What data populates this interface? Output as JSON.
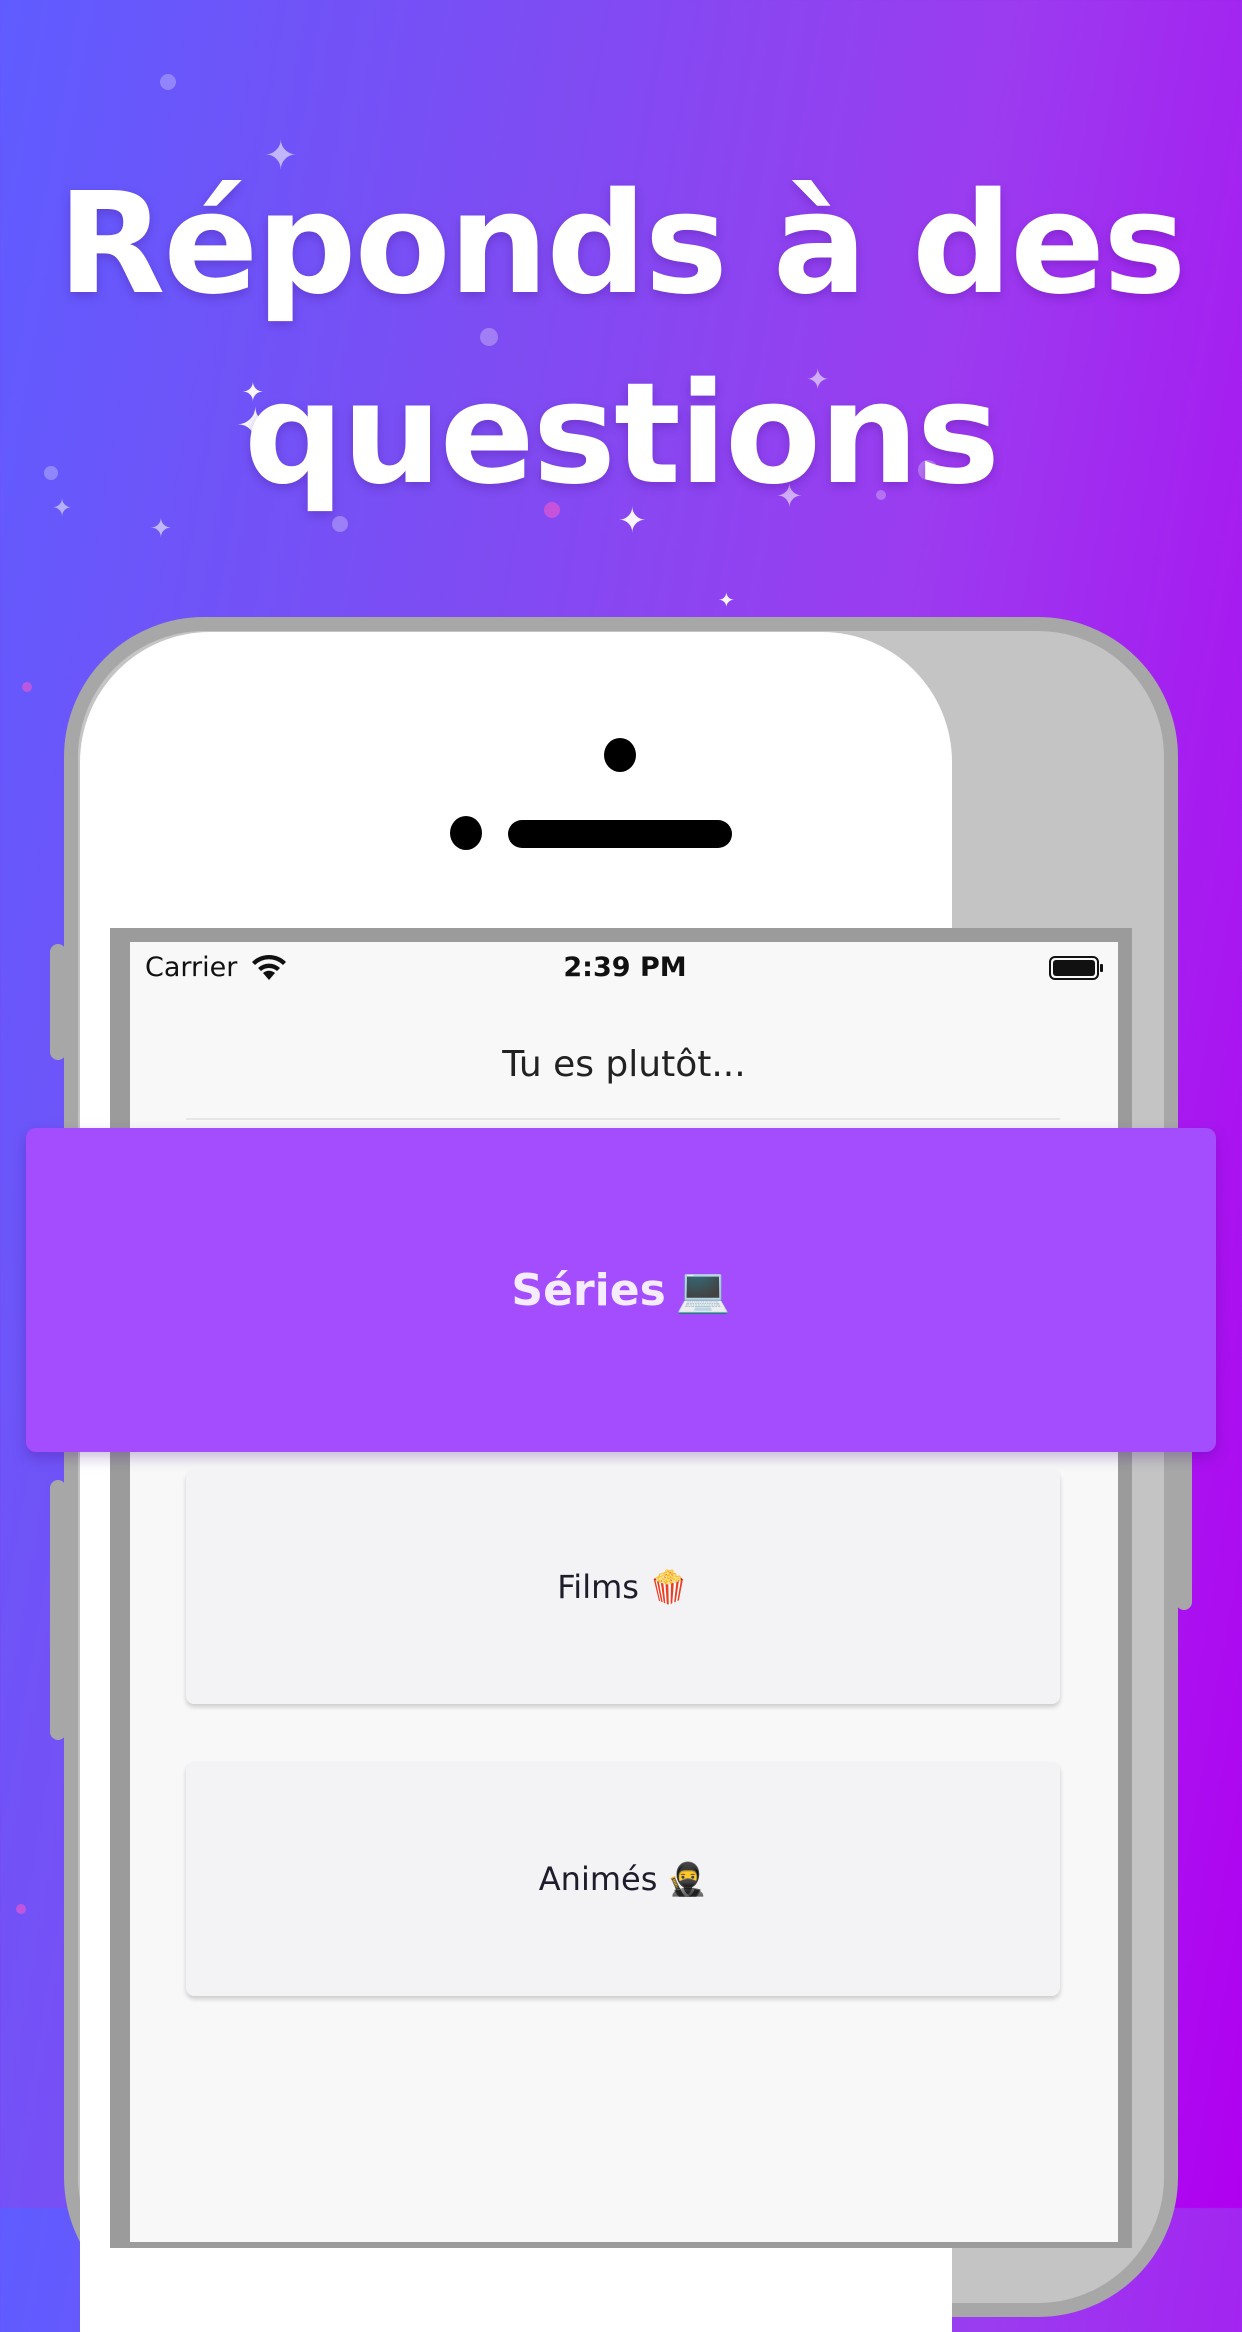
{
  "headline": {
    "line1": "Réponds à des",
    "line2": "questions"
  },
  "status_bar": {
    "carrier": "Carrier",
    "time": "2:39 PM"
  },
  "quiz": {
    "question": "Tu es plutôt...",
    "choices": [
      {
        "label": "Séries",
        "emoji": "💻",
        "selected": true
      },
      {
        "label": "Films",
        "emoji": "🍿",
        "selected": false
      },
      {
        "label": "Animés",
        "emoji": "🥷",
        "selected": false
      }
    ]
  },
  "colors": {
    "background_start": "#5f5cff",
    "background_end": "#b000f0",
    "selected_choice": "#a34dff",
    "choice_background": "#f3f3f5"
  }
}
